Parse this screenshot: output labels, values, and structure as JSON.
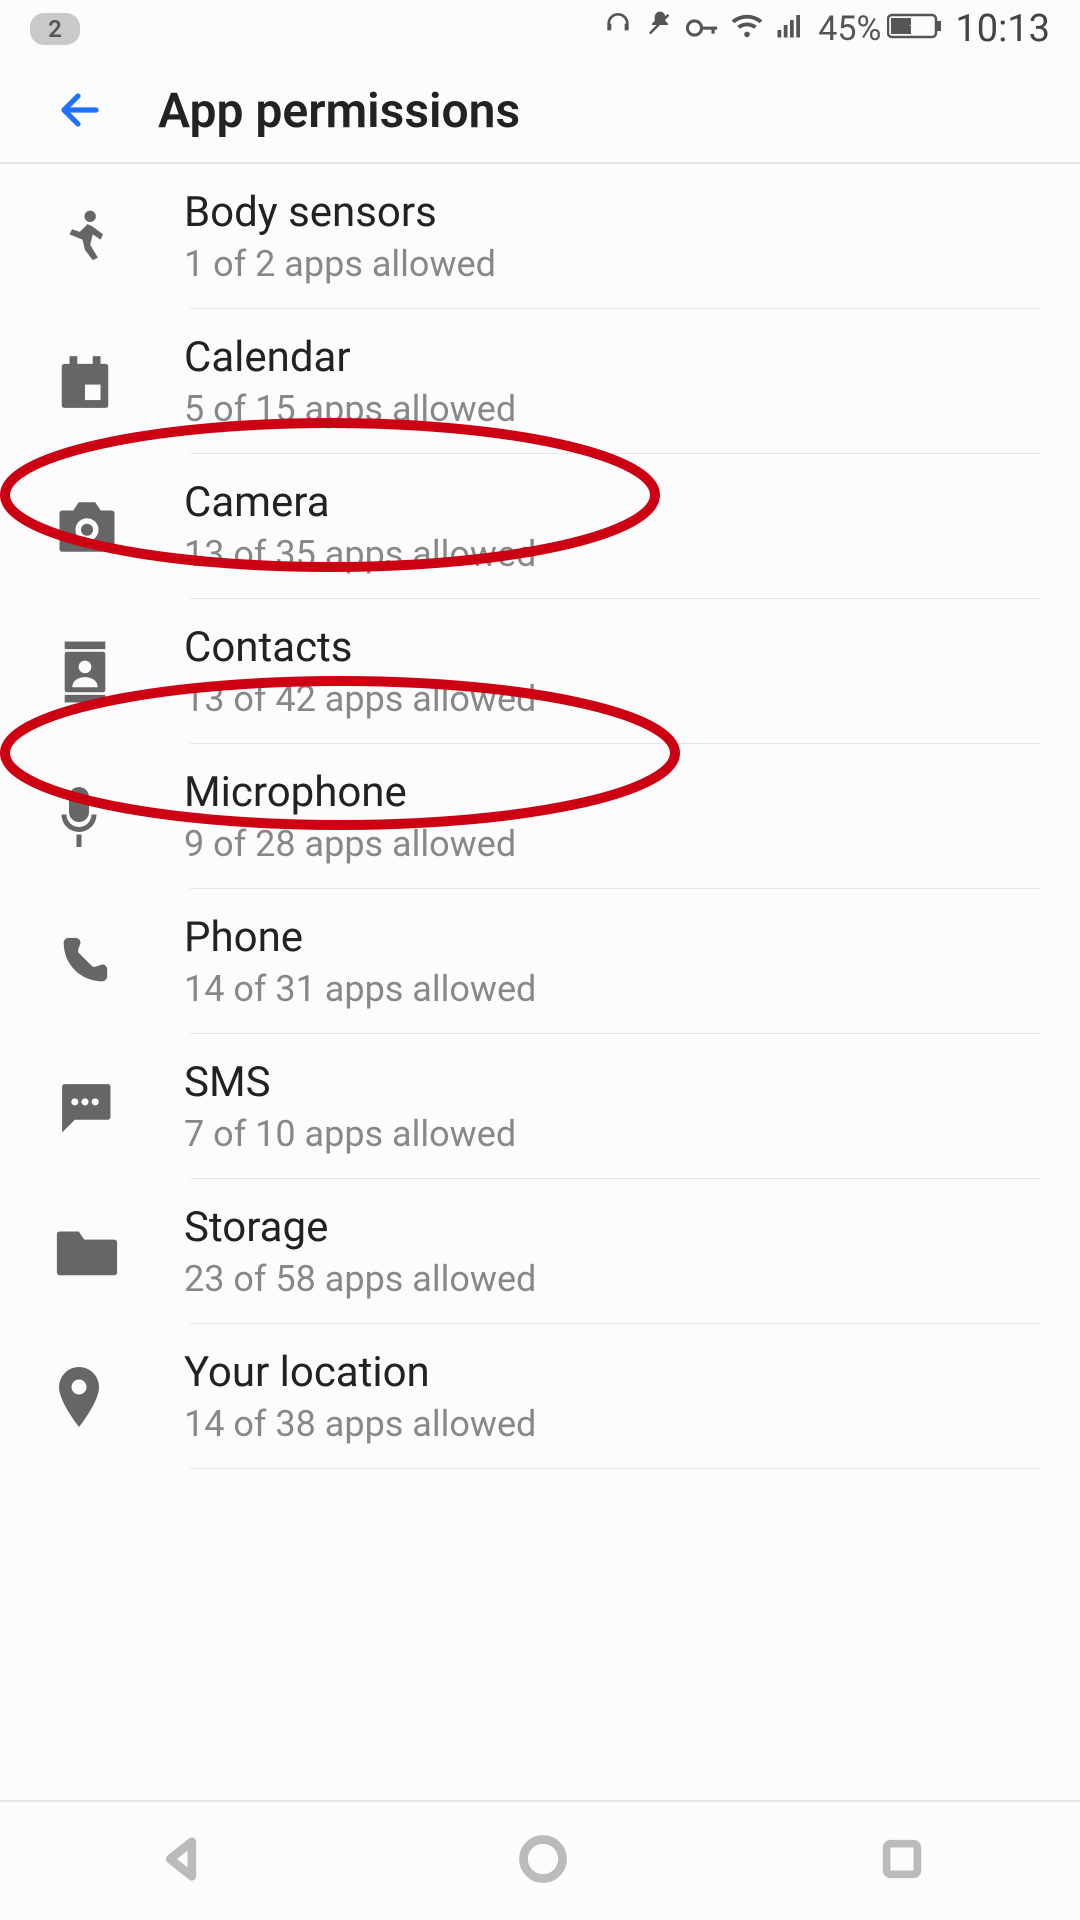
{
  "status": {
    "notification_count": "2",
    "battery_percent": "45%",
    "time": "10:13"
  },
  "header": {
    "title": "App permissions"
  },
  "permissions": [
    {
      "title": "Body sensors",
      "sub": "1 of 2 apps allowed",
      "icon": "running-icon"
    },
    {
      "title": "Calendar",
      "sub": "5 of 15 apps allowed",
      "icon": "calendar-icon"
    },
    {
      "title": "Camera",
      "sub": "13 of 35 apps allowed",
      "icon": "camera-icon"
    },
    {
      "title": "Contacts",
      "sub": "13 of 42 apps allowed",
      "icon": "contacts-icon"
    },
    {
      "title": "Microphone",
      "sub": "9 of 28 apps allowed",
      "icon": "mic-icon"
    },
    {
      "title": "Phone",
      "sub": "14 of 31 apps allowed",
      "icon": "phone-icon"
    },
    {
      "title": "SMS",
      "sub": "7 of 10 apps allowed",
      "icon": "sms-icon"
    },
    {
      "title": "Storage",
      "sub": "23 of 58 apps allowed",
      "icon": "folder-icon"
    },
    {
      "title": "Your location",
      "sub": "14 of 38 apps allowed",
      "icon": "location-icon"
    }
  ],
  "annotations": {
    "circled_indices": [
      2,
      4
    ]
  }
}
